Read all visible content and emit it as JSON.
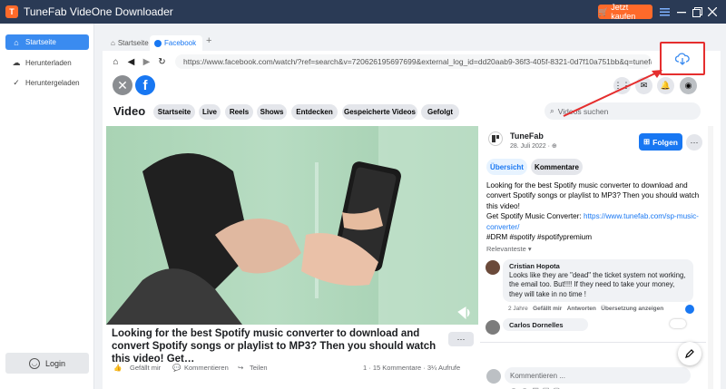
{
  "app": {
    "title": "TuneFab VideOne Downloader",
    "logo_letter": "T",
    "buy_label": "Jetzt kaufen",
    "window_controls": [
      "menu-icon",
      "minimize-icon",
      "restore-icon",
      "close-icon"
    ]
  },
  "sidebar": {
    "items": [
      {
        "label": "Startseite",
        "icon": "home-icon",
        "active": true
      },
      {
        "label": "Herunterladen",
        "icon": "cloud-download-icon",
        "active": false
      },
      {
        "label": "Heruntergeladen",
        "icon": "check-circle-icon",
        "active": false
      }
    ],
    "login_label": "Login"
  },
  "browser": {
    "tabs": [
      {
        "label": "Startseite",
        "icon": "home-icon",
        "active": false
      },
      {
        "label": "Facebook",
        "icon": "facebook-icon",
        "active": true
      }
    ],
    "add_tab": "+",
    "url": "https://www.facebook.com/watch/?ref=search&v=720626195697699&external_log_id=dd20aab9-36f3-405f-8321-0d7f10a751bb&q=tunefab"
  },
  "facebook": {
    "logo_letter": "f",
    "video_heading": "Video",
    "nav_chips": [
      "Startseite",
      "Live",
      "Reels",
      "Shows",
      "Entdecken",
      "Gespeicherte Videos",
      "Gefolgt"
    ],
    "search_placeholder": "Videos suchen",
    "video_post_title": "Looking for the best Spotify music converter to download and convert Spotify songs or playlist to MP3? Then you should watch this video! Get…",
    "more_label": "···",
    "actions": {
      "like": "Gefällt mir",
      "comment": "Kommentieren",
      "share": "Teilen",
      "counts": "1 · 15 Kommentare · 3¼ Aufrufe"
    },
    "post": {
      "page_name": "TuneFab",
      "date": "28. Juli 2022 · ",
      "follow_label": "Folgen",
      "tab_overview": "Übersicht",
      "tab_comments": "Kommentare",
      "desc_line1": "Looking for the best Spotify music converter to download and convert Spotify songs or playlist to MP3? Then you should watch this video!",
      "desc_get": "Get Spotify Music Converter: ",
      "desc_link": "https://www.tunefab.com/sp-music-converter/",
      "desc_tags": "#DRM #spotify #spotifypremium",
      "relevance": "Relevanteste ",
      "comments": [
        {
          "name": "Cristian Hopota",
          "text": "Looks like they are \"dead\" the ticket system not working, the email too. But!!!! If they need to take your money, they will take in no time !",
          "age": "2 Jahre",
          "like": "Gefällt mir",
          "reply": "Antworten",
          "translate": "Übersetzung anzeigen"
        },
        {
          "name": "Carlos Dornelles",
          "text": "",
          "age": "",
          "like": "",
          "reply": "",
          "translate": ""
        }
      ],
      "write_placeholder": "Kommentieren ..."
    }
  }
}
